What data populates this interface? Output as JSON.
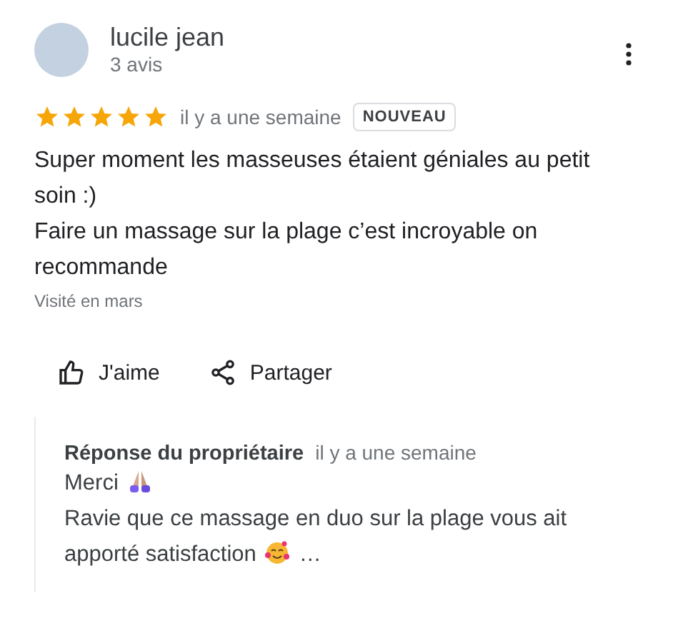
{
  "author": {
    "name": "lucile jean",
    "reviews": "3 avis"
  },
  "review": {
    "stars": 5,
    "date": "il y a une semaine",
    "badge": "NOUVEAU",
    "paragraphs": [
      "Super moment les masseuses étaient géniales au petit soin :)",
      "Faire un massage sur la plage c’est incroyable on recommande"
    ],
    "visited": "Visité en mars"
  },
  "actions": [
    {
      "kind": "like",
      "label": "J'aime"
    },
    {
      "kind": "share",
      "label": "Partager"
    }
  ],
  "reply": {
    "title": "Réponse du propriétaire",
    "date": "il y a une semaine",
    "lines": [
      [
        {
          "kind": "text",
          "text": "Merci"
        },
        {
          "kind": "praying-hands"
        }
      ],
      [
        {
          "kind": "text",
          "text": "Ravie que ce massage en duo sur la plage vous ait"
        }
      ],
      [
        {
          "kind": "text",
          "text": "apporté satisfaction"
        },
        {
          "kind": "smiling-face"
        },
        {
          "kind": "text",
          "text": "…"
        }
      ]
    ]
  }
}
